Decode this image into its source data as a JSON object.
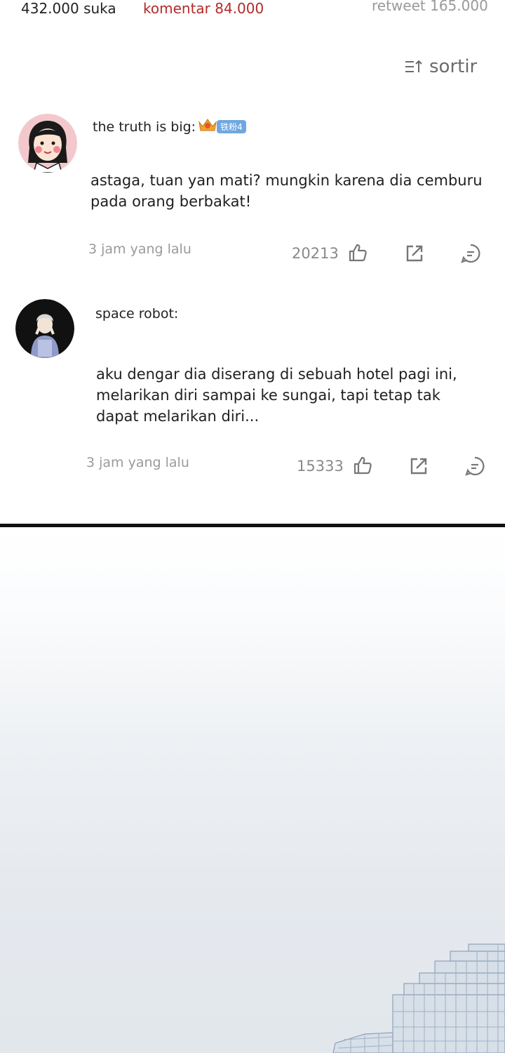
{
  "stats": {
    "likes": "432.000 suka",
    "comments": "komentar 84.000",
    "retweets": "retweet 165.000"
  },
  "sort": {
    "label": "sortir",
    "icon": "sort-icon"
  },
  "comments": [
    {
      "username": "the truth is big:",
      "badge": "铁粉4",
      "text": "astaga, tuan yan mati? mungkin karena dia cemburu pada orang berbakat!",
      "time": "3 jam yang lalu",
      "likes": "20213"
    },
    {
      "username": "space robot:",
      "text": "aku dengar dia diserang di sebuah hotel pagi ini, melarikan diri sampai ke sungai, tapi tetap tak dapat melarikan diri...",
      "time": "3 jam yang lalu",
      "likes": "15333"
    }
  ],
  "colors": {
    "comments_accent": "#b42a2a",
    "muted": "#9a9a9a",
    "badge": "#6fa8e0",
    "divider": "#111111",
    "sky": "#e2e7ec",
    "building": "#a8b8cc"
  }
}
